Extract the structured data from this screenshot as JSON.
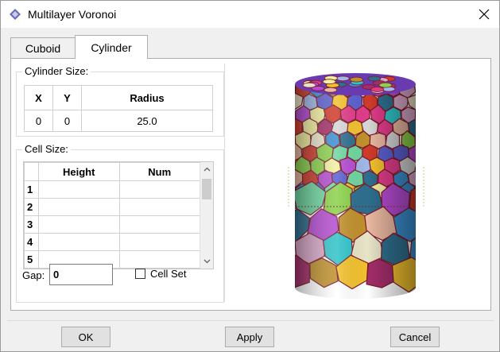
{
  "window": {
    "title": "Multilayer Voronoi"
  },
  "tabs": [
    {
      "label": "Cuboid",
      "active": false
    },
    {
      "label": "Cylinder",
      "active": true
    }
  ],
  "cylinder_size": {
    "label": "Cylinder Size:",
    "headers": [
      "X",
      "Y",
      "Radius"
    ],
    "values": [
      "0",
      "0",
      "25.0"
    ]
  },
  "cell_size": {
    "label": "Cell Size:",
    "headers": [
      "Height",
      "Num"
    ],
    "row_numbers": [
      "1",
      "2",
      "3",
      "4",
      "5"
    ]
  },
  "gap": {
    "label": "Gap:",
    "value": "0"
  },
  "cell_set": {
    "label": "Cell Set",
    "checked": false
  },
  "buttons": {
    "ok": "OK",
    "apply": "Apply",
    "cancel": "Cancel"
  },
  "colors": {
    "accent": "#0078d7",
    "cell_edge": "#7a1a2a"
  }
}
